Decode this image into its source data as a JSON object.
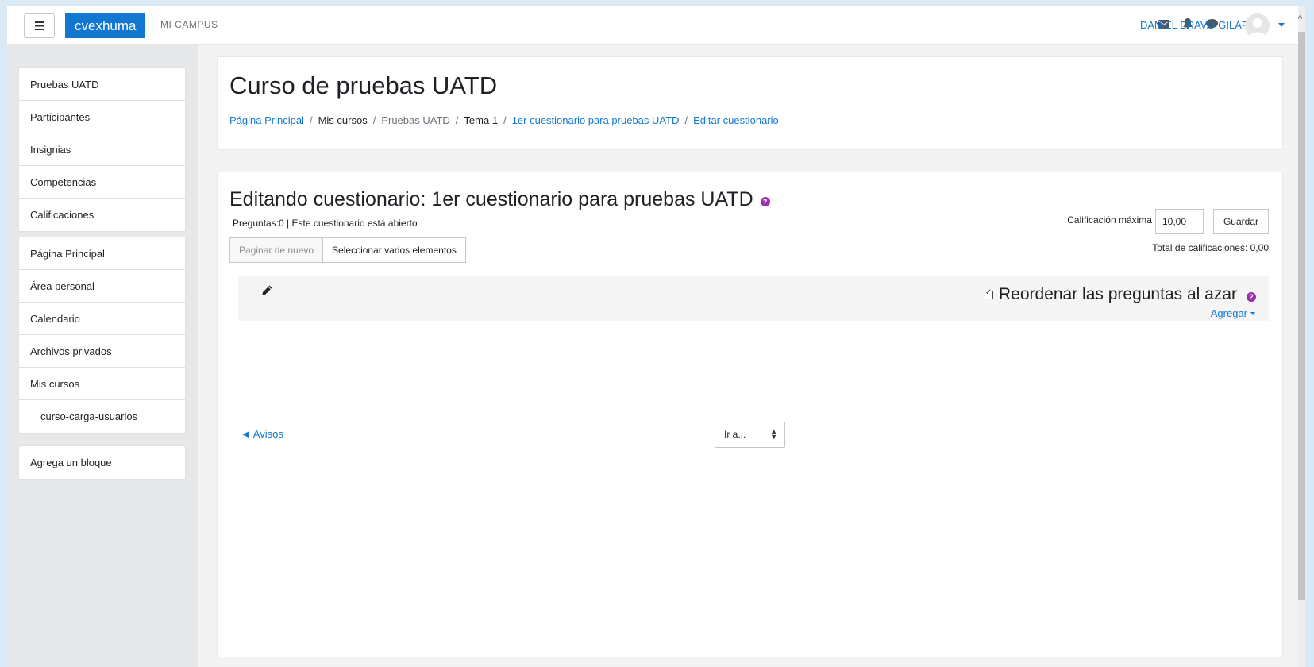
{
  "header": {
    "brand": "cvexhuma",
    "site_link": "MI CAMPUS",
    "user_name": "DANIEL BRAVO GILAR"
  },
  "drawer": {
    "course_items": [
      "Pruebas UATD",
      "Participantes",
      "Insignias",
      "Competencias",
      "Calificaciones"
    ],
    "site_items": [
      "Página Principal",
      "Área personal",
      "Calendario",
      "Archivos privados",
      "Mis cursos"
    ],
    "sub_item": "curso-carga-usuarios",
    "add_block": "Agrega un bloque"
  },
  "page": {
    "course_title": "Curso de pruebas UATD",
    "breadcrumb": [
      "Página Principal",
      "Mis cursos",
      "Pruebas UATD",
      "Tema 1",
      "1er cuestionario para pruebas UATD",
      "Editar cuestionario"
    ]
  },
  "quiz": {
    "title": "Editando cuestionario: 1er cuestionario para pruebas UATD",
    "status": "Preguntas:0 | Este cuestionario está abierto",
    "repaginate_label": "Paginar de nuevo",
    "select_multiple_label": "Seleccionar varios elementos",
    "max_grade_label": "Calificación máxima",
    "max_grade_value": "10,00",
    "save_label": "Guardar",
    "total_label": "Total de calificaciones: 0,00",
    "shuffle_label": "Reordenar las preguntas al azar",
    "shuffle_checked": true,
    "add_label": "Agregar",
    "prev_link": "◄ Avisos",
    "jump_label": "Ir a...",
    "help_icon_glyph": "?"
  },
  "colors": {
    "accent": "#1177d1",
    "help_icon": "#9b2fae",
    "drawer_bg": "#e7e8ea"
  }
}
